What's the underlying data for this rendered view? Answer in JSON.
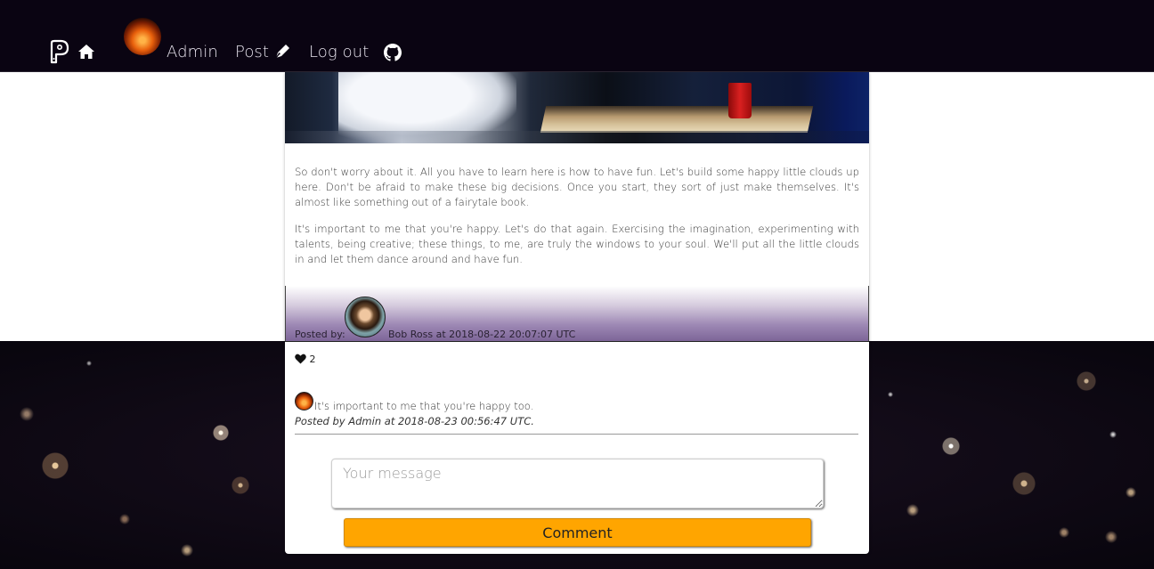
{
  "nav": {
    "logo_icon": "p-logo-icon",
    "home_icon": "home-icon",
    "user_label": "Admin",
    "post_label": "Post",
    "post_icon": "pen-icon",
    "logout_label": "Log out",
    "github_icon": "github-icon"
  },
  "post": {
    "paragraphs": [
      "So don't worry about it. All you have to learn here is how to have fun. Let's build some happy little clouds up here. Don't be afraid to make these big decisions. Once you start, they sort of just make themselves. It's almost like something out of a fairytale book.",
      "It's important to me that you're happy. Let's do that again. Exercising the imagination, experimenting with talents, being creative; these things, to me, are truly the windows to your soul. We'll put all the little clouds in and let them dance around and have fun."
    ],
    "posted_by_label": "Posted by:",
    "author_line": "Bob Ross at 2018-08-22 20:07:07 UTC",
    "likes": "2",
    "like_icon": "heart-icon"
  },
  "comments": [
    {
      "text": "It's important to me that you're happy too.",
      "meta": "Posted by Admin at 2018-08-23 00:56:47 UTC."
    }
  ],
  "form": {
    "placeholder": "Your message",
    "value": "",
    "submit_label": "Comment",
    "submit_color": "#ffa500"
  },
  "colors": {
    "navbar_bg": "#0a0412",
    "footer_gradient_end": "#7d6598"
  }
}
